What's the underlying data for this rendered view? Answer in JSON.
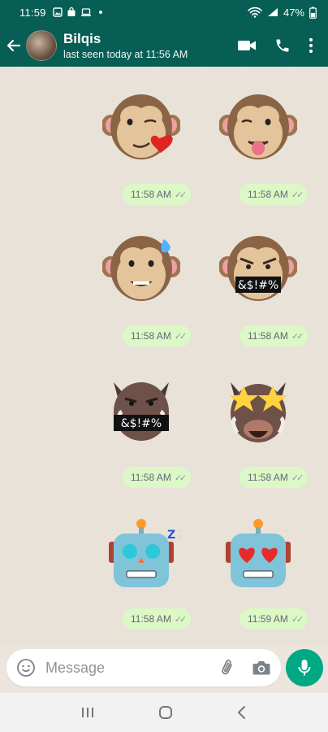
{
  "status_bar": {
    "time": "11:59",
    "battery": "47%"
  },
  "header": {
    "name": "Bilqis",
    "status": "last seen today at 11:56 AM"
  },
  "stickers": [
    {
      "name": "monkey-heart-sticker",
      "time": "11:58 AM"
    },
    {
      "name": "monkey-tongue-sticker",
      "time": "11:58 AM"
    },
    {
      "name": "monkey-sweat-sticker",
      "time": "11:58 AM"
    },
    {
      "name": "monkey-swear-sticker",
      "time": "11:58 AM",
      "caption": "&$!#%"
    },
    {
      "name": "boar-swear-sticker",
      "time": "11:58 AM",
      "caption": "&$!#%"
    },
    {
      "name": "boar-star-eyes-sticker",
      "time": "11:58 AM"
    },
    {
      "name": "robot-sleep-sticker",
      "time": "11:58 AM",
      "zzz": "Z Z Z"
    },
    {
      "name": "robot-heart-eyes-sticker",
      "time": "11:59 AM"
    }
  ],
  "input": {
    "placeholder": "Message"
  },
  "colors": {
    "header": "#075e54",
    "bubble": "#dcf8c6",
    "mic": "#00a884"
  }
}
